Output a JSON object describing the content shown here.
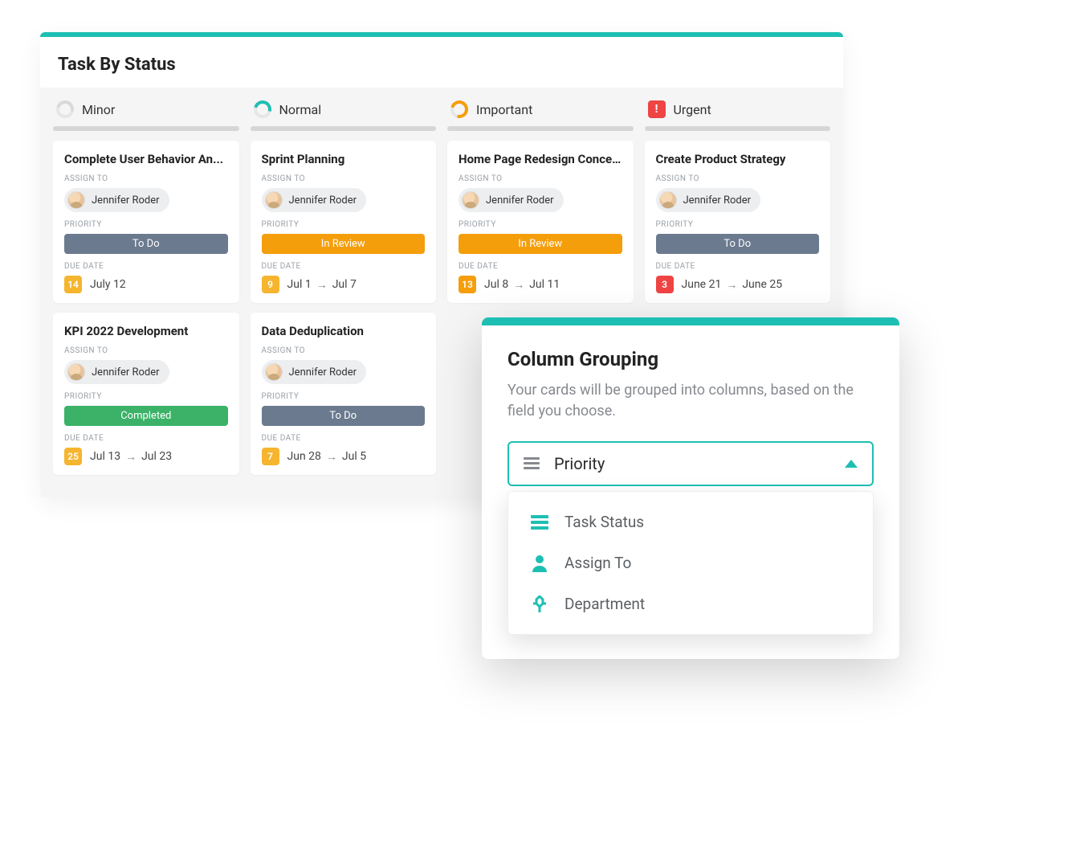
{
  "board": {
    "title": "Task By Status",
    "field_labels": {
      "assign": "ASSIGN TO",
      "priority": "PRIORITY",
      "due": "DUE DATE"
    },
    "columns": [
      {
        "name": "Minor",
        "icon": "minor",
        "cards": [
          {
            "title": "Complete User Behavior An...",
            "assignee": "Jennifer Roder",
            "status_label": "To Do",
            "status_class": "todo",
            "due_badge": "14",
            "due_badge_class": "amber",
            "due_start": "July 12",
            "due_end": ""
          },
          {
            "title": "KPI 2022 Development",
            "assignee": "Jennifer Roder",
            "status_label": "Completed",
            "status_class": "done",
            "due_badge": "25",
            "due_badge_class": "amber",
            "due_start": "Jul 13",
            "due_end": "Jul 23"
          }
        ]
      },
      {
        "name": "Normal",
        "icon": "normal",
        "cards": [
          {
            "title": "Sprint Planning",
            "assignee": "Jennifer Roder",
            "status_label": "In Review",
            "status_class": "review",
            "due_badge": "9",
            "due_badge_class": "amber",
            "due_start": "Jul 1",
            "due_end": "Jul 7"
          },
          {
            "title": "Data Deduplication",
            "assignee": "Jennifer Roder",
            "status_label": "To Do",
            "status_class": "todo",
            "due_badge": "7",
            "due_badge_class": "amber",
            "due_start": "Jun 28",
            "due_end": "Jul 5"
          }
        ]
      },
      {
        "name": "Important",
        "icon": "important",
        "cards": [
          {
            "title": "Home Page Redesign Conce...",
            "assignee": "Jennifer Roder",
            "status_label": "In Review",
            "status_class": "review",
            "due_badge": "13",
            "due_badge_class": "orange",
            "due_start": "Jul 8",
            "due_end": "Jul 11"
          }
        ]
      },
      {
        "name": "Urgent",
        "icon": "urgent",
        "cards": [
          {
            "title": "Create Product Strategy",
            "assignee": "Jennifer Roder",
            "status_label": "To Do",
            "status_class": "todo",
            "due_badge": "3",
            "due_badge_class": "red",
            "due_start": "June 21",
            "due_end": "June 25"
          }
        ]
      }
    ]
  },
  "grouping_popup": {
    "title": "Column Grouping",
    "description": "Your cards will be grouped into columns, based on the field you choose.",
    "selected": "Priority",
    "options": [
      {
        "icon": "list",
        "label": "Task Status"
      },
      {
        "icon": "person",
        "label": "Assign To"
      },
      {
        "icon": "dept",
        "label": "Department"
      }
    ]
  }
}
